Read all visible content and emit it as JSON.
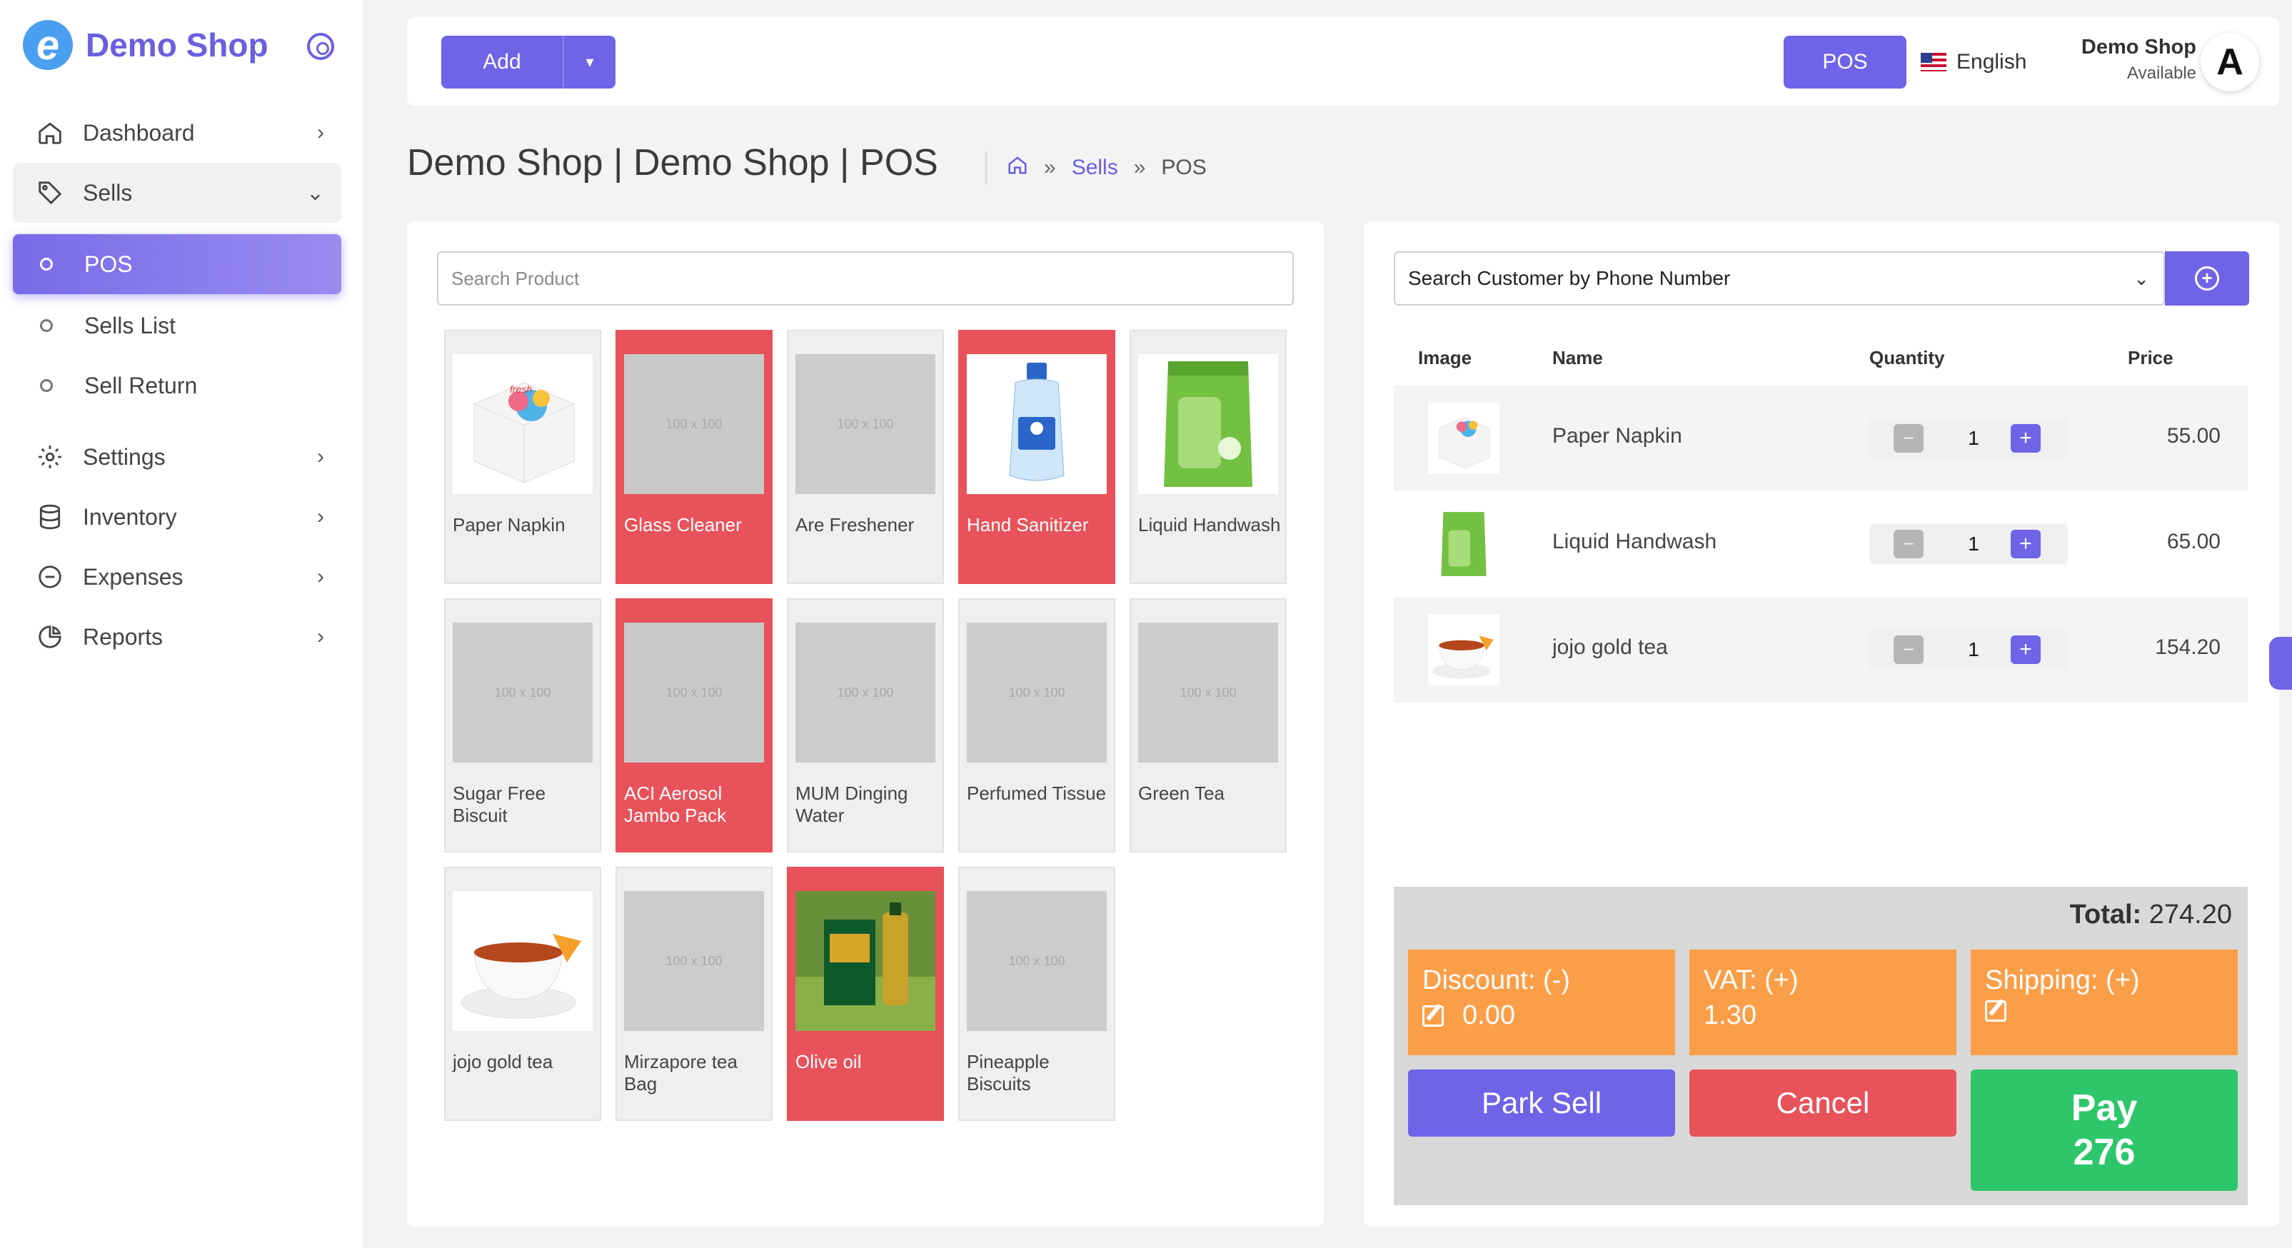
{
  "brand": {
    "name": "Demo Shop",
    "logo_letter": "e"
  },
  "sidebar": {
    "items": [
      {
        "label": "Dashboard",
        "icon": "home-icon"
      },
      {
        "label": "Sells",
        "icon": "tag-icon"
      },
      {
        "label": "Settings",
        "icon": "gear-icon"
      },
      {
        "label": "Inventory",
        "icon": "database-icon"
      },
      {
        "label": "Expenses",
        "icon": "minus-circle-icon"
      },
      {
        "label": "Reports",
        "icon": "pie-chart-icon"
      }
    ],
    "sells_sub": [
      "POS",
      "Sells List",
      "Sell Return"
    ]
  },
  "topbar": {
    "add_label": "Add",
    "pos_label": "POS",
    "language": "English",
    "user_name": "Demo Shop",
    "user_status": "Available",
    "avatar_letter": "A"
  },
  "page": {
    "title": "Demo Shop | Demo Shop | POS",
    "crumbs": {
      "sells": "Sells",
      "current": "POS",
      "separator": "»"
    }
  },
  "products": {
    "search_placeholder": "Search Product",
    "placeholder_text": "100 x 100",
    "items": [
      {
        "name": "Paper Napkin",
        "stock_out": false
      },
      {
        "name": "Glass Cleaner",
        "stock_out": true
      },
      {
        "name": "Are Freshener",
        "stock_out": false
      },
      {
        "name": "Hand Sanitizer",
        "stock_out": true
      },
      {
        "name": "Liquid Handwash",
        "stock_out": false
      },
      {
        "name": "Sugar Free Biscuit",
        "stock_out": false
      },
      {
        "name": "ACI Aerosol Jambo Pack",
        "stock_out": true
      },
      {
        "name": "MUM Dinging Water",
        "stock_out": false
      },
      {
        "name": "Perfumed Tissue",
        "stock_out": false
      },
      {
        "name": "Green Tea",
        "stock_out": false
      },
      {
        "name": "jojo gold tea",
        "stock_out": false
      },
      {
        "name": "Mirzapore tea Bag",
        "stock_out": false
      },
      {
        "name": "Olive oil",
        "stock_out": true
      },
      {
        "name": "Pineapple Biscuits",
        "stock_out": false
      }
    ]
  },
  "cart": {
    "customer_placeholder": "Search Customer by Phone Number",
    "headers": {
      "image": "Image",
      "name": "Name",
      "quantity": "Quantity",
      "price": "Price"
    },
    "rows": [
      {
        "name": "Paper Napkin",
        "qty": "1",
        "price": "55.00"
      },
      {
        "name": "Liquid Handwash",
        "qty": "1",
        "price": "65.00"
      },
      {
        "name": "jojo gold tea",
        "qty": "1",
        "price": "154.20"
      }
    ],
    "total_label": "Total:",
    "total_value": "274.20",
    "discount_label": "Discount: (-)",
    "discount_value": "0.00",
    "vat_label": "VAT: (+)",
    "vat_value": "1.30",
    "shipping_label": "Shipping: (+)",
    "park_label": "Park Sell",
    "cancel_label": "Cancel",
    "pay_label": "Pay",
    "pay_amount": "276"
  },
  "colors": {
    "accent": "#6f63e8",
    "danger": "#e8525a",
    "warning": "#fb9e48",
    "success": "#2ec66a"
  }
}
